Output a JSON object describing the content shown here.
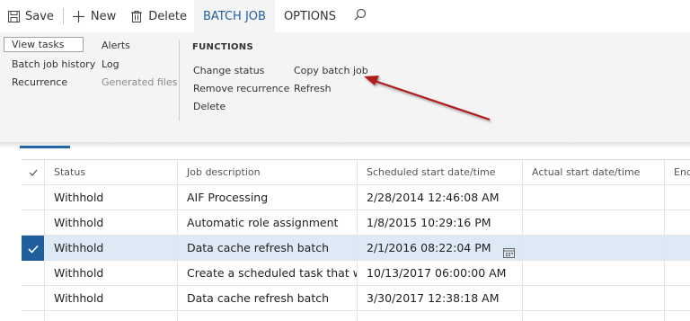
{
  "toolbar": {
    "save_label": "Save",
    "new_label": "New",
    "delete_label": "Delete",
    "tabs": [
      {
        "label": "BATCH JOB",
        "active": true
      },
      {
        "label": "OPTIONS",
        "active": false
      }
    ],
    "search_icon": "search-icon"
  },
  "ribbon": {
    "col1": [
      "View tasks",
      "Batch job history",
      "Recurrence"
    ],
    "col2": [
      "Alerts",
      "Log",
      "Generated files"
    ],
    "functions_heading": "FUNCTIONS",
    "functions_col1": [
      "Change status",
      "Remove recurrence",
      "Delete"
    ],
    "functions_col2": [
      "Copy batch job",
      "Refresh"
    ]
  },
  "grid": {
    "headers": [
      "Status",
      "Job description",
      "Scheduled start date/time",
      "Actual start date/time",
      "End"
    ],
    "rows": [
      {
        "status": "Withhold",
        "description": "AIF Processing",
        "scheduled": "2/28/2014 12:46:08 AM",
        "actual": "",
        "selected": false
      },
      {
        "status": "Withhold",
        "description": "Automatic role assignment",
        "scheduled": "1/8/2015 10:29:16 PM",
        "actual": "",
        "selected": false
      },
      {
        "status": "Withhold",
        "description": "Data cache refresh batch",
        "scheduled": "2/1/2016 08:22:04 PM",
        "actual": "",
        "selected": true
      },
      {
        "status": "Withhold",
        "description": "Create a scheduled task that will...",
        "scheduled": "10/13/2017 06:00:00 AM",
        "actual": "",
        "selected": false
      },
      {
        "status": "Withhold",
        "description": "Data cache refresh batch",
        "scheduled": "3/30/2017 12:38:18 AM",
        "actual": "",
        "selected": false
      }
    ]
  },
  "colors": {
    "accent": "#1f5f9e",
    "selected_row": "#dde9f5",
    "annotation_arrow": "#b01e1e"
  }
}
